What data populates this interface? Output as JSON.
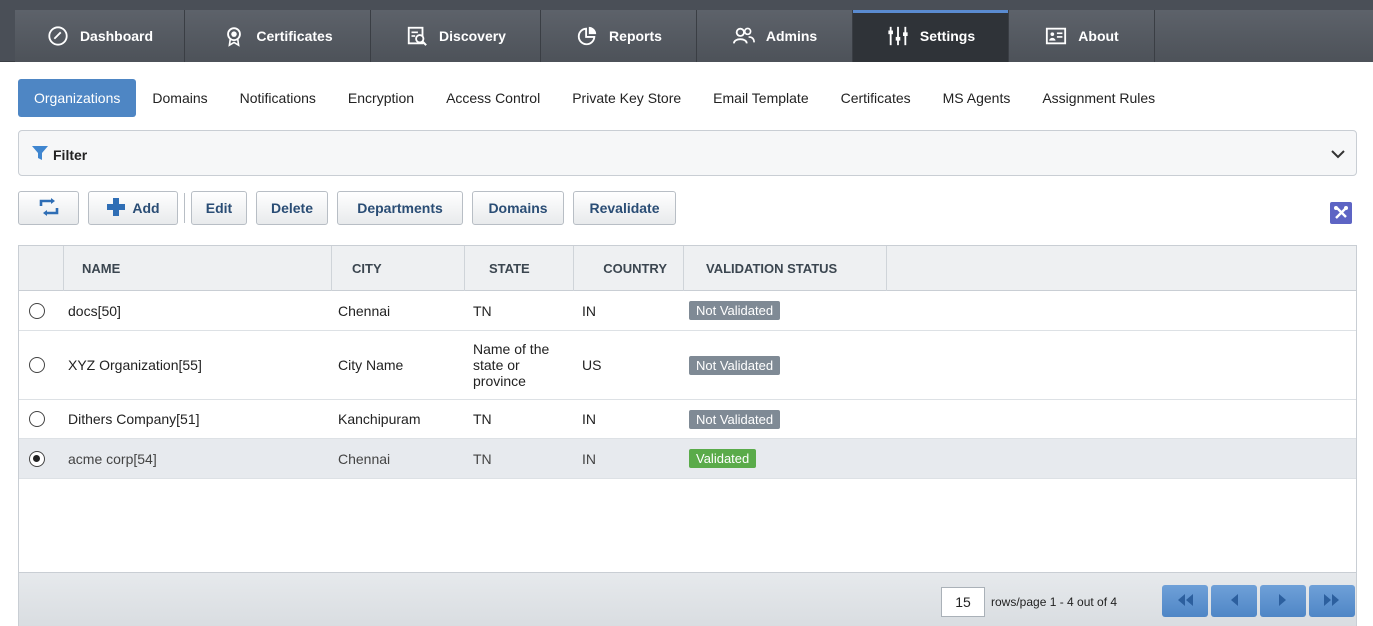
{
  "topnav": {
    "tabs": [
      {
        "label": "Dashboard",
        "icon": "dashboard-icon"
      },
      {
        "label": "Certificates",
        "icon": "certificate-icon"
      },
      {
        "label": "Discovery",
        "icon": "discovery-icon"
      },
      {
        "label": "Reports",
        "icon": "reports-icon"
      },
      {
        "label": "Admins",
        "icon": "admins-icon"
      },
      {
        "label": "Settings",
        "icon": "settings-sliders-icon",
        "active": true
      },
      {
        "label": "About",
        "icon": "about-icon"
      }
    ]
  },
  "subnav": {
    "items": [
      {
        "label": "Organizations",
        "active": true
      },
      {
        "label": "Domains"
      },
      {
        "label": "Notifications"
      },
      {
        "label": "Encryption"
      },
      {
        "label": "Access Control"
      },
      {
        "label": "Private Key Store"
      },
      {
        "label": "Email Template"
      },
      {
        "label": "Certificates"
      },
      {
        "label": "MS Agents"
      },
      {
        "label": "Assignment Rules"
      }
    ]
  },
  "filter": {
    "label": "Filter"
  },
  "toolbar": {
    "add": "Add",
    "edit": "Edit",
    "delete": "Delete",
    "departments": "Departments",
    "domains": "Domains",
    "revalidate": "Revalidate"
  },
  "table": {
    "columns": [
      "NAME",
      "CITY",
      "STATE",
      "COUNTRY",
      "VALIDATION STATUS"
    ],
    "rows": [
      {
        "name": "docs[50]",
        "city": "Chennai",
        "state": "TN",
        "country": "IN",
        "status": "Not Validated",
        "selected": false
      },
      {
        "name": "XYZ Organization[55]",
        "city": "City Name",
        "state": "Name of the state or province",
        "country": "US",
        "status": "Not Validated",
        "selected": false
      },
      {
        "name": "Dithers Company[51]",
        "city": "Kanchipuram",
        "state": "TN",
        "country": "IN",
        "status": "Not Validated",
        "selected": false
      },
      {
        "name": "acme corp[54]",
        "city": "Chennai",
        "state": "TN",
        "country": "IN",
        "status": "Validated",
        "selected": true
      }
    ]
  },
  "pagination": {
    "rows_per_page": "15",
    "text": "rows/page  1 - 4 out of 4"
  },
  "colors": {
    "accent": "#4e86c4",
    "validated": "#5aab4a",
    "not_validated": "#7f8a95",
    "nav_bg": "#4a4f57"
  }
}
